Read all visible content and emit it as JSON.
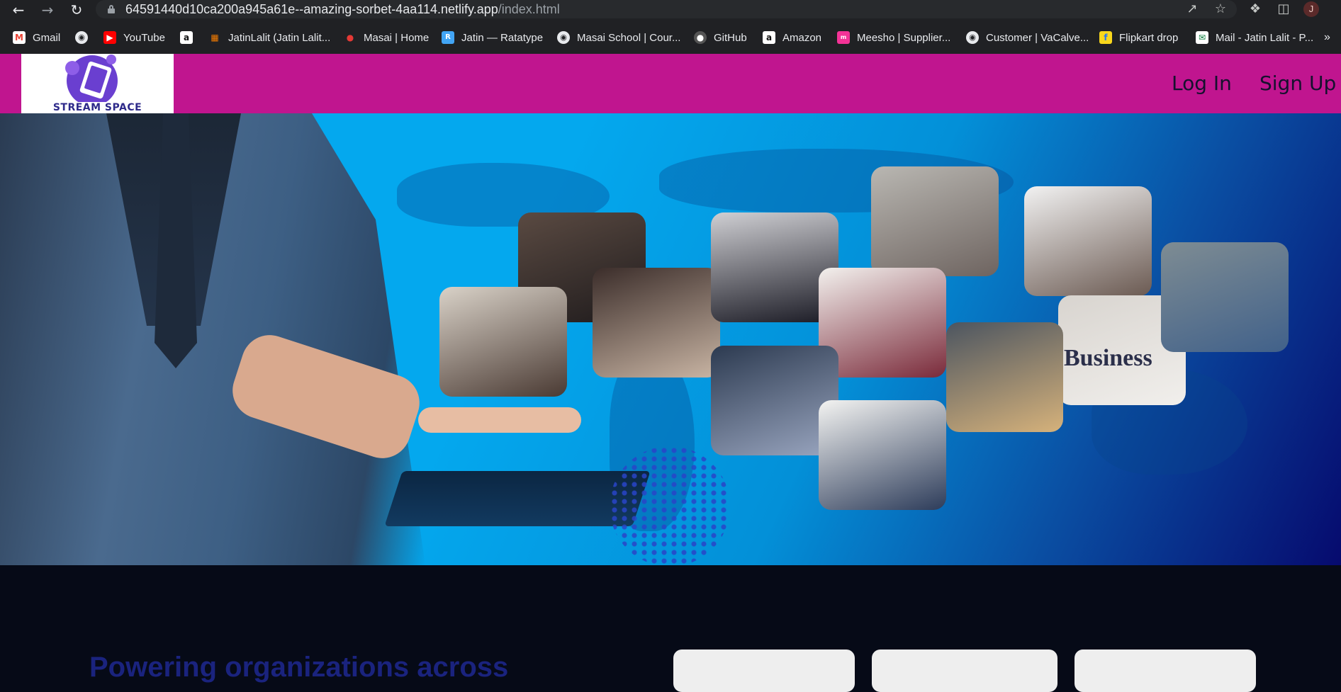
{
  "browser": {
    "url_host": "64591440d10ca200a945a61e--amazing-sorbet-4aa114.netlify.app",
    "url_path": "/index.html",
    "profile_initial": "J",
    "icons": [
      "back-icon",
      "forward-icon",
      "reload-icon",
      "lock-icon",
      "share-icon",
      "star-icon",
      "extensions-icon",
      "side-panel-icon"
    ],
    "bookmarks": [
      {
        "label": "Gmail",
        "icon": "gmail-icon",
        "color": "#ea4335"
      },
      {
        "label": "",
        "icon": "globe-icon",
        "color": "#e8eaed"
      },
      {
        "label": "YouTube",
        "icon": "youtube-icon",
        "color": "#ff0000"
      },
      {
        "label": "",
        "icon": "amazon-icon",
        "color": "#ffffff"
      },
      {
        "label": "JatinLalit (Jatin Lalit...",
        "icon": "profile-icon",
        "color": "#f57c00"
      },
      {
        "label": "Masai | Home",
        "icon": "masai-icon",
        "color": "#e53935"
      },
      {
        "label": "Jatin — Ratatype",
        "icon": "ratatype-icon",
        "color": "#42a5f5"
      },
      {
        "label": "Masai School | Cour...",
        "icon": "globe-icon",
        "color": "#e8eaed"
      },
      {
        "label": "GitHub",
        "icon": "github-icon",
        "color": "#555555"
      },
      {
        "label": "Amazon",
        "icon": "amazon-icon",
        "color": "#ffffff"
      },
      {
        "label": "Meesho | Supplier...",
        "icon": "meesho-icon",
        "color": "#f43397"
      },
      {
        "label": "Customer | VaCalve...",
        "icon": "globe-icon",
        "color": "#e8eaed"
      },
      {
        "label": "Flipkart drop",
        "icon": "flipkart-icon",
        "color": "#f9d71c"
      },
      {
        "label": "Mail - Jatin Lalit - P...",
        "icon": "mail-icon",
        "color": "#ffffff"
      }
    ]
  },
  "header": {
    "logo_text": "STREAM SPACE",
    "login_label": "Log In",
    "signup_label": "Sign Up"
  },
  "hero": {
    "newspaper_text": "Business"
  },
  "section": {
    "title": "Powering organizations across"
  },
  "colors": {
    "header_bg": "#c0158f",
    "logo_purple": "#6a3fd0",
    "page_bg": "#060a17",
    "title_color": "#1a237e"
  }
}
